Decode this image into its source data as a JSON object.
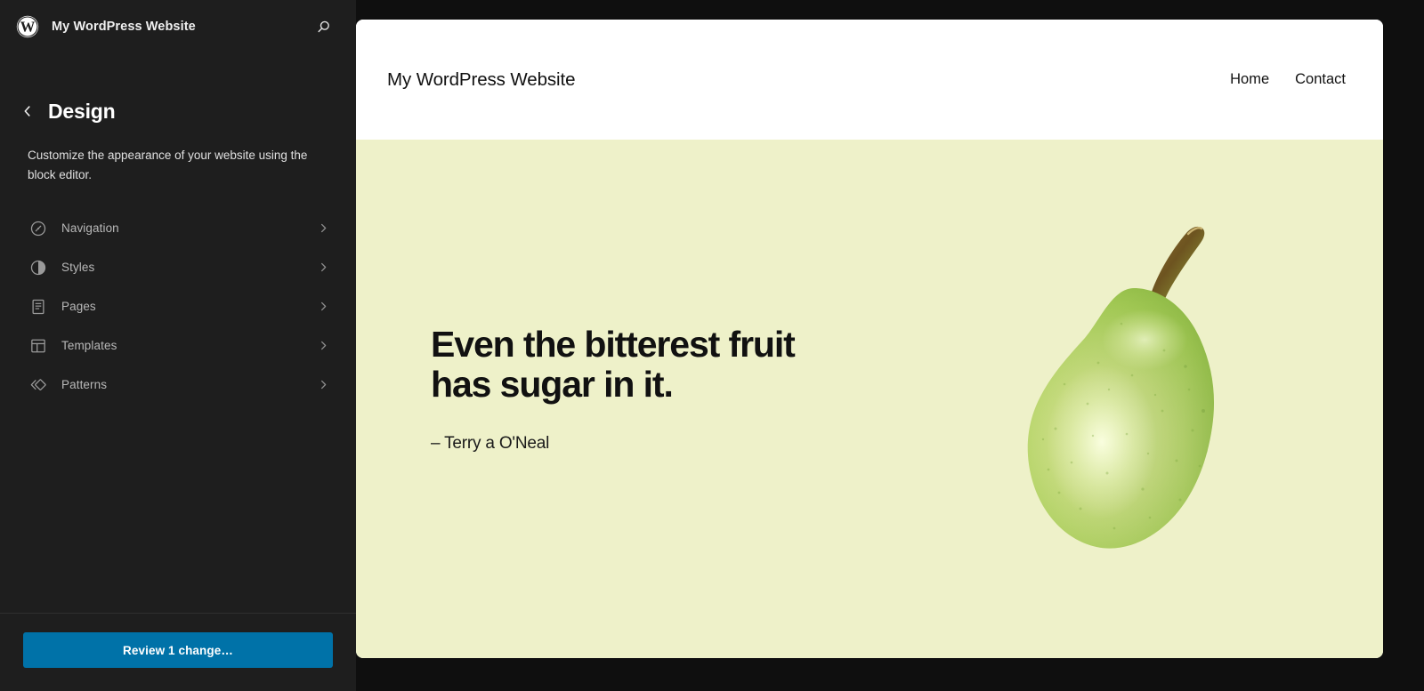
{
  "sidebar": {
    "header": {
      "logo_icon": "wordpress-logo-icon",
      "site_name": "My WordPress Website",
      "search_icon": "search-icon"
    },
    "panel": {
      "back_icon": "chevron-left-icon",
      "title": "Design",
      "description": "Customize the appearance of your website using the block editor."
    },
    "items": [
      {
        "label": "Navigation",
        "icon": "compass-icon",
        "chevron": "chevron-right-icon"
      },
      {
        "label": "Styles",
        "icon": "contrast-half-circle-icon",
        "chevron": "chevron-right-icon"
      },
      {
        "label": "Pages",
        "icon": "page-document-icon",
        "chevron": "chevron-right-icon"
      },
      {
        "label": "Templates",
        "icon": "layout-template-icon",
        "chevron": "chevron-right-icon"
      },
      {
        "label": "Patterns",
        "icon": "patterns-diamond-icon",
        "chevron": "chevron-right-icon"
      }
    ],
    "footer": {
      "review_label": "Review 1 change…"
    }
  },
  "preview": {
    "header": {
      "site_title": "My WordPress Website",
      "nav": [
        {
          "label": "Home"
        },
        {
          "label": "Contact"
        }
      ]
    },
    "hero": {
      "quote_line_1": "Even the bitterest fruit",
      "quote_line_2": "has sugar in it.",
      "attribution": "– Terry a O'Neal",
      "image_alt": "pear-illustration"
    }
  },
  "colors": {
    "sidebar_bg": "#1e1e1e",
    "frame_bg": "#0f0f0f",
    "accent_button": "#0072a8",
    "hero_bg": "#eef1c9",
    "label_text": "#b8b8b8"
  }
}
